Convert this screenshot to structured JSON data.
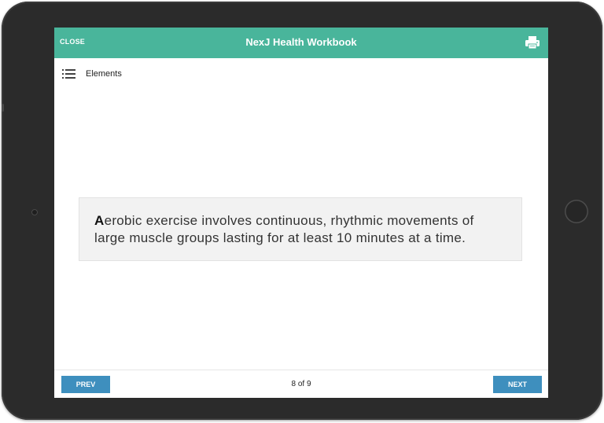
{
  "header": {
    "close_label": "CLOSE",
    "title": "NexJ Health Workbook",
    "print_icon": "printer-icon"
  },
  "toolbar": {
    "elements_icon": "list-icon",
    "elements_label": "Elements"
  },
  "content": {
    "dropcap": "A",
    "text": "erobic exercise involves continuous, rhythmic movements of large muscle groups lasting for at least 10 minutes at a time."
  },
  "footer": {
    "prev_label": "PREV",
    "page_indicator": "8 of 9",
    "next_label": "NEXT"
  },
  "colors": {
    "header_bg": "#49b59b",
    "nav_button_bg": "#3e8fbe",
    "content_box_bg": "#f2f2f2",
    "device_frame": "#2b2b2b"
  }
}
